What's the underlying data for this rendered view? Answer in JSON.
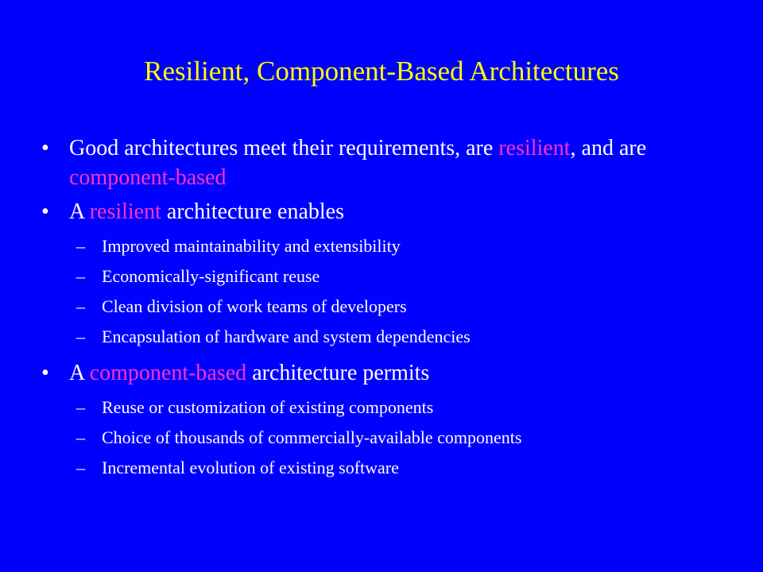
{
  "slide": {
    "title": "Resilient, Component-Based Architectures",
    "colors": {
      "background": "#0000ff",
      "title": "#ffff00",
      "text": "#ffffff",
      "highlight": "#ff33cc"
    },
    "bullet_marker": "•",
    "sub_marker": "–",
    "bullets": [
      {
        "parts": [
          "Good architectures meet their requirements, are ",
          "resilient",
          ", and are ",
          "component-based"
        ]
      },
      {
        "parts": [
          "A ",
          "resilient",
          " architecture enables"
        ],
        "subs": [
          "Improved maintainability and extensibility",
          "Economically-significant reuse",
          "Clean division of work teams of developers",
          "Encapsulation of hardware and system dependencies"
        ]
      },
      {
        "parts": [
          "A ",
          "component-based",
          " architecture permits"
        ],
        "subs": [
          "Reuse or customization of existing components",
          "Choice of thousands of commercially-available components",
          "Incremental evolution of existing software"
        ]
      }
    ]
  }
}
